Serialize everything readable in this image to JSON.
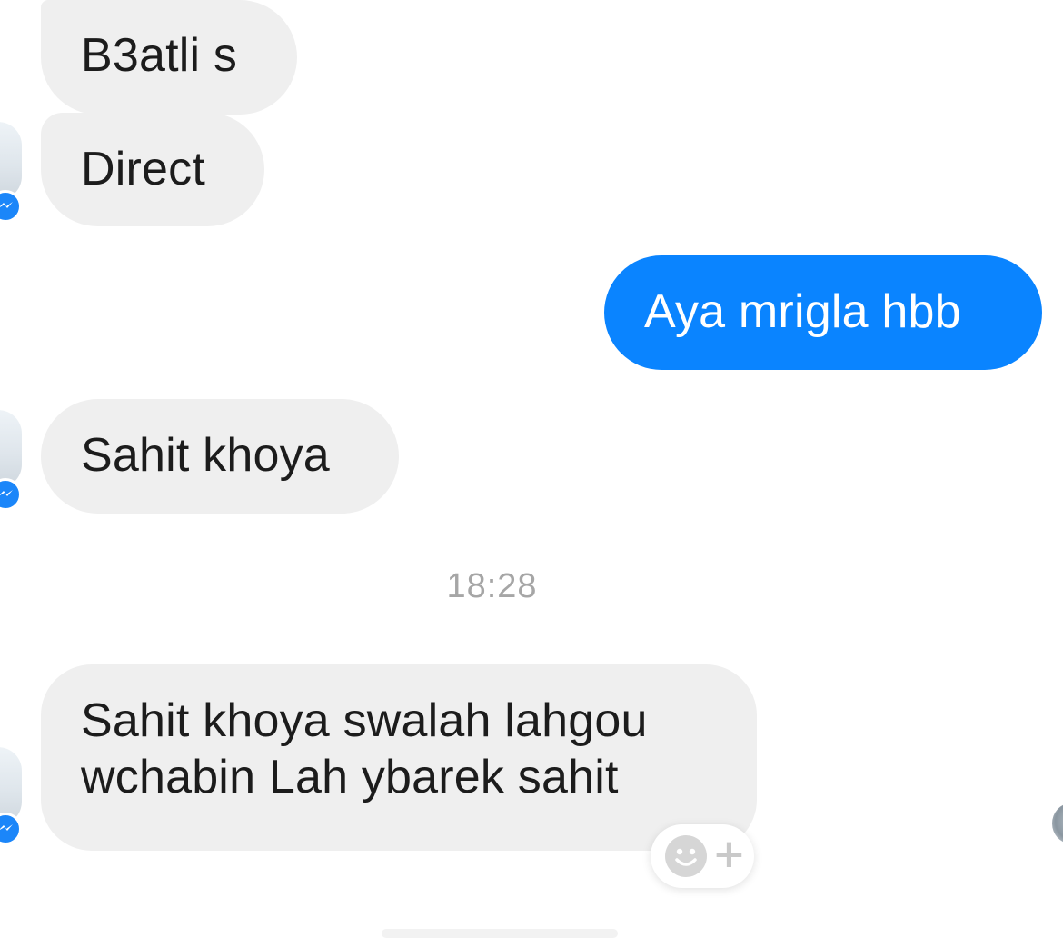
{
  "conversation": {
    "messages": [
      {
        "direction": "incoming",
        "text": "B3atli s"
      },
      {
        "direction": "incoming",
        "text": "Direct"
      },
      {
        "direction": "outgoing",
        "text": "Aya mrigla hbb"
      },
      {
        "direction": "incoming",
        "text": "Sahit khoya"
      },
      {
        "direction": "incoming",
        "lines": [
          "Sahit khoya swalah lahgou",
          "wchabin Lah ybarek sahit"
        ]
      }
    ],
    "timestamp": "18:28"
  },
  "icons": {
    "messenger_badge": "messenger-badge-icon",
    "reaction_face": "emoji-face-icon",
    "reaction_plus": "plus-icon"
  },
  "reaction_button": {
    "plus_label": "+"
  },
  "colors": {
    "incoming_bubble": "#efefef",
    "outgoing_bubble": "#0a84ff",
    "badge": "#1b86f9",
    "timestamp": "#a6a6a6"
  }
}
